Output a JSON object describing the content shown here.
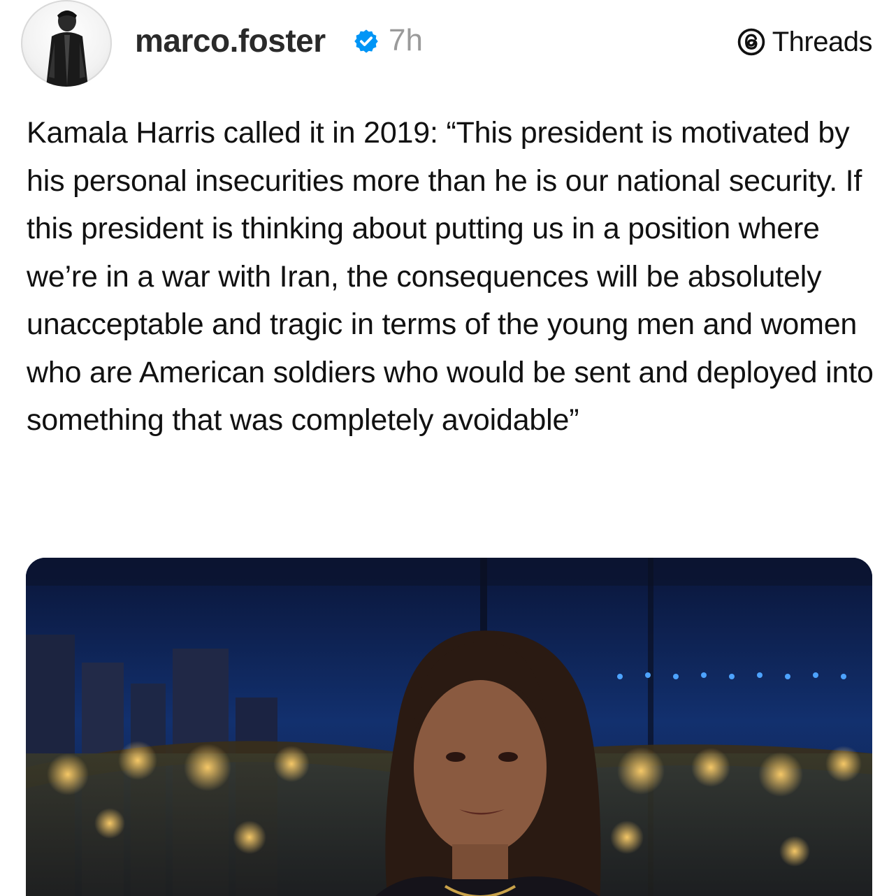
{
  "post": {
    "author": {
      "username": "marco.foster",
      "verified": true,
      "verified_icon": "verified-badge-icon",
      "avatar_icon": "avatar"
    },
    "timestamp": "7h",
    "brand": {
      "icon": "threads-logo-icon",
      "label": "Threads"
    },
    "body": "Kamala Harris called it in 2019: “This president is motivated by his personal insecurities more than he is our national security. If this president is thinking about putting us in a position where we’re in a war with Iran, the consequences will be absolutely unacceptable and tragic in terms of the young men and women who are American soldiers who would be sent and deployed into something that was completely avoidable”",
    "media": {
      "kind": "image"
    }
  },
  "colors": {
    "background": "#ffffff",
    "text": "#111111",
    "username": "#2a2a2a",
    "timestamp": "#9a9a9a",
    "verified_blue": "#0095f6",
    "media_sky": "#0b1840"
  }
}
